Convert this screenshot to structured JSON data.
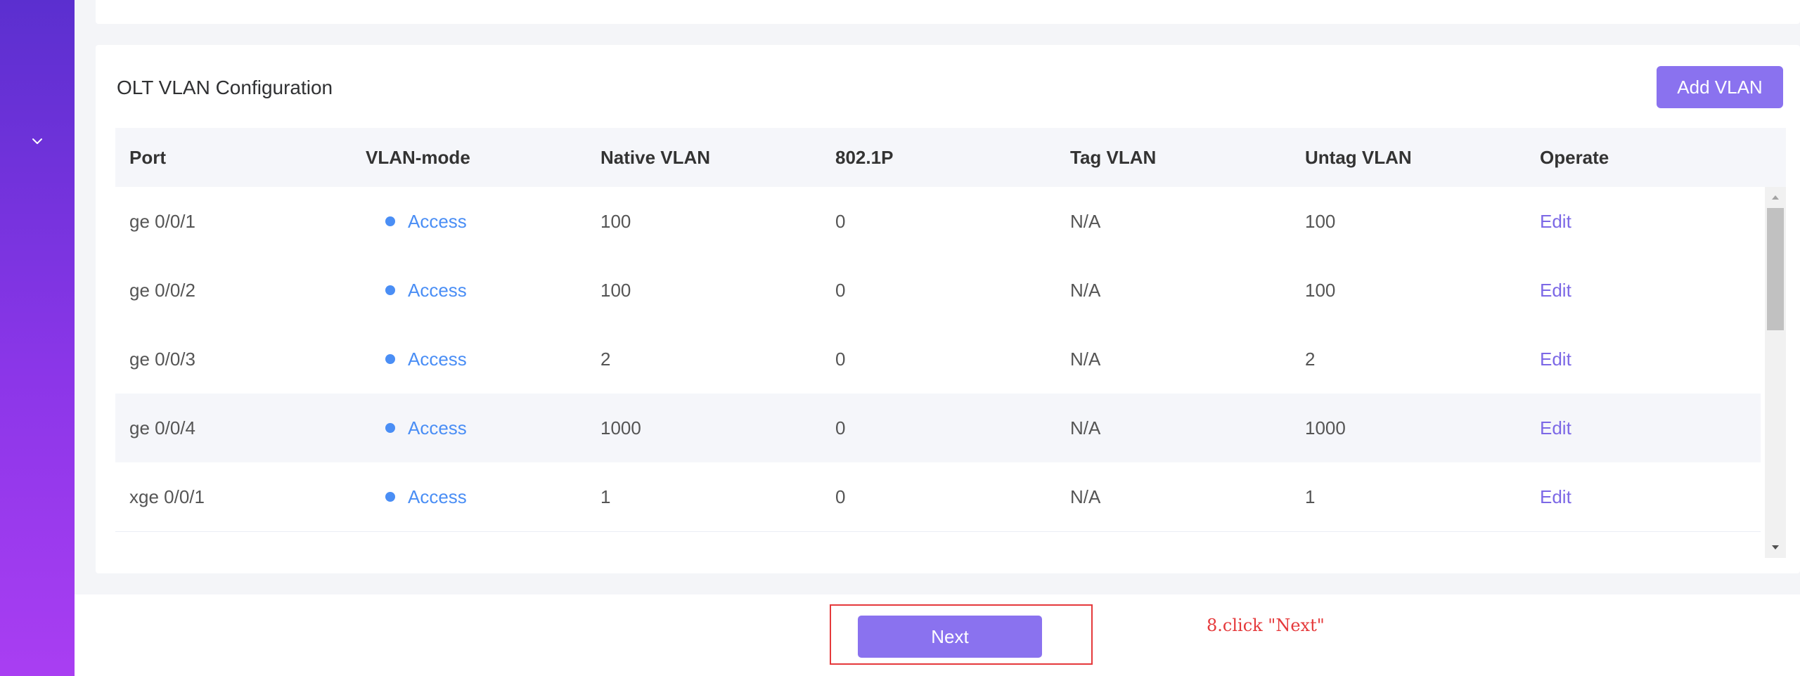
{
  "sidebar": {
    "expand_icon": "chevron-down-icon"
  },
  "vlan_card": {
    "title": "OLT VLAN Configuration",
    "add_button_label": "Add VLAN",
    "columns": [
      "Port",
      "VLAN-mode",
      "Native VLAN",
      "802.1P",
      "Tag VLAN",
      "Untag VLAN",
      "Operate"
    ],
    "rows": [
      {
        "port": "ge 0/0/1",
        "mode": "Access",
        "native_vlan": "100",
        "p8021": "0",
        "tag_vlan": "N/A",
        "untag_vlan": "100",
        "operate": "Edit"
      },
      {
        "port": "ge 0/0/2",
        "mode": "Access",
        "native_vlan": "100",
        "p8021": "0",
        "tag_vlan": "N/A",
        "untag_vlan": "100",
        "operate": "Edit"
      },
      {
        "port": "ge 0/0/3",
        "mode": "Access",
        "native_vlan": "2",
        "p8021": "0",
        "tag_vlan": "N/A",
        "untag_vlan": "2",
        "operate": "Edit"
      },
      {
        "port": "ge 0/0/4",
        "mode": "Access",
        "native_vlan": "1000",
        "p8021": "0",
        "tag_vlan": "N/A",
        "untag_vlan": "1000",
        "operate": "Edit"
      },
      {
        "port": "xge 0/0/1",
        "mode": "Access",
        "native_vlan": "1",
        "p8021": "0",
        "tag_vlan": "N/A",
        "untag_vlan": "1",
        "operate": "Edit"
      }
    ]
  },
  "footer": {
    "next_label": "Next",
    "annotation": "8.click \"Next\""
  },
  "colors": {
    "primary_button": "#8a72ef",
    "mode_blue": "#4a8ef5",
    "annotation_red": "#e5393b",
    "sidebar_top": "#5b2fcf",
    "sidebar_bottom": "#a93ef2"
  }
}
